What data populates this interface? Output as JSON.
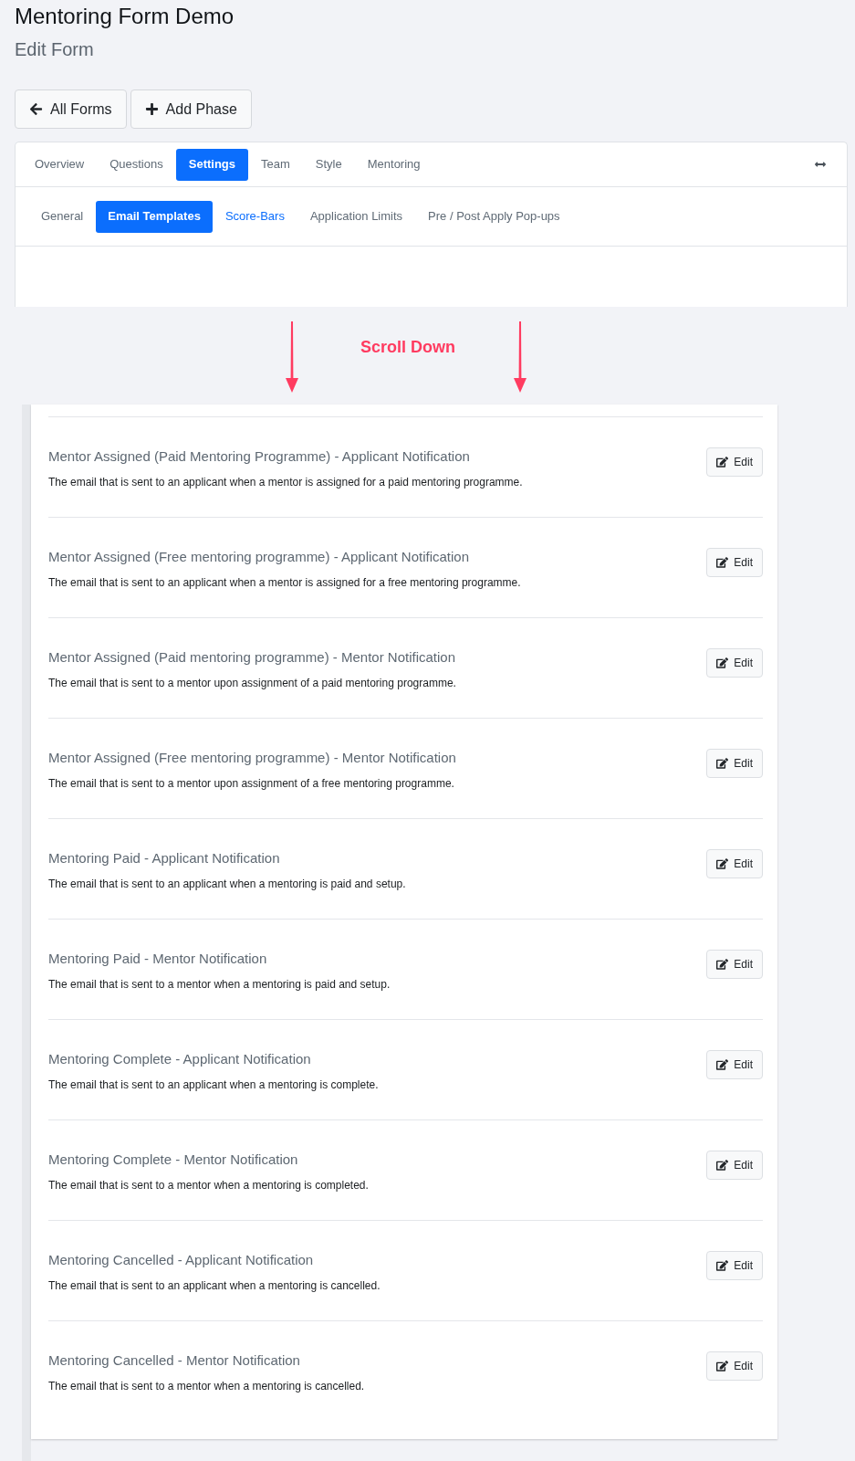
{
  "header": {
    "title": "Mentoring Form Demo",
    "subtitle": "Edit Form"
  },
  "actions": [
    {
      "kind": "back",
      "label": "All Forms"
    },
    {
      "kind": "add",
      "label": "Add Phase"
    }
  ],
  "tabs": [
    {
      "label": "Overview",
      "selected": false
    },
    {
      "label": "Questions",
      "selected": false
    },
    {
      "label": "Settings",
      "selected": true
    },
    {
      "label": "Team",
      "selected": false
    },
    {
      "label": "Style",
      "selected": false
    },
    {
      "label": "Mentoring",
      "selected": false
    }
  ],
  "sub_tabs": [
    {
      "label": "General",
      "selected": false,
      "hovered": false
    },
    {
      "label": "Email Templates",
      "selected": true,
      "hovered": false
    },
    {
      "label": "Score-Bars",
      "selected": false,
      "hovered": true
    },
    {
      "label": "Application Limits",
      "selected": false,
      "hovered": false
    },
    {
      "label": "Pre / Post Apply Pop-ups",
      "selected": false,
      "hovered": false
    }
  ],
  "annotation": {
    "text": "Scroll Down"
  },
  "email_templates": [
    {
      "title": "Mentor Assigned (Paid Mentoring Programme) - Applicant Notification",
      "description": "The email that is sent to an applicant when a mentor is assigned for a paid mentoring programme.",
      "action": "Edit"
    },
    {
      "title": "Mentor Assigned (Free mentoring programme) - Applicant Notification",
      "description": "The email that is sent to an applicant when a mentor is assigned for a free mentoring programme.",
      "action": "Edit"
    },
    {
      "title": "Mentor Assigned (Paid mentoring programme) - Mentor Notification",
      "description": "The email that is sent to a mentor upon assignment of a paid mentoring programme.",
      "action": "Edit"
    },
    {
      "title": "Mentor Assigned (Free mentoring programme) - Mentor Notification",
      "description": "The email that is sent to a mentor upon assignment of a free mentoring programme.",
      "action": "Edit"
    },
    {
      "title": "Mentoring Paid - Applicant Notification",
      "description": "The email that is sent to an applicant when a mentoring is paid and setup.",
      "action": "Edit"
    },
    {
      "title": "Mentoring Paid - Mentor Notification",
      "description": "The email that is sent to a mentor when a mentoring is paid and setup.",
      "action": "Edit"
    },
    {
      "title": "Mentoring Complete - Applicant Notification",
      "description": "The email that is sent to an applicant when a mentoring is complete.",
      "action": "Edit"
    },
    {
      "title": "Mentoring Complete - Mentor Notification",
      "description": "The email that is sent to a mentor when a mentoring is completed.",
      "action": "Edit"
    },
    {
      "title": "Mentoring Cancelled - Applicant Notification",
      "description": "The email that is sent to an applicant when a mentoring is cancelled.",
      "action": "Edit"
    },
    {
      "title": "Mentoring Cancelled - Mentor Notification",
      "description": "The email that is sent to a mentor when a mentoring is cancelled.",
      "action": "Edit"
    }
  ]
}
